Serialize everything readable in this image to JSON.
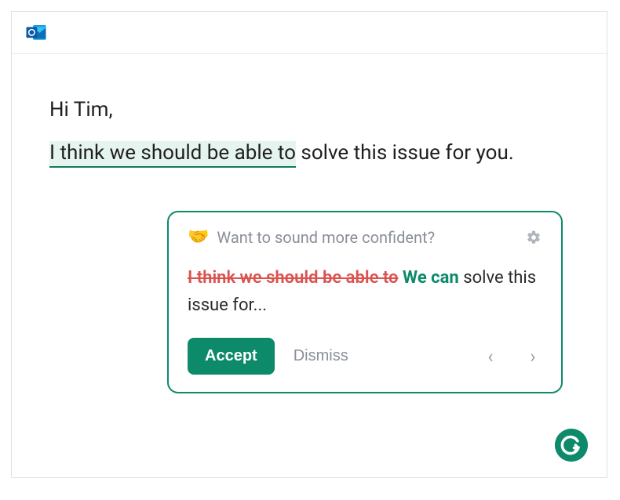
{
  "email": {
    "greeting": "Hi Tim,",
    "highlighted_phrase": "I think we should be able to",
    "rest_of_sentence": " solve this issue for you."
  },
  "suggestion": {
    "handshake_emoji": "🤝",
    "prompt": "Want to sound more confident?",
    "strike_text": "I think we should be able to",
    "replacement_text": " We can",
    "trailing_text": " solve this issue for...",
    "accept_label": "Accept",
    "dismiss_label": "Dismiss"
  },
  "icons": {
    "outlook": "outlook-icon",
    "gear": "gear-icon",
    "prev": "‹",
    "next": "›",
    "grammarly": "grammarly-icon"
  },
  "colors": {
    "accent_green": "#0d8a6a",
    "strike_red": "#d9534f",
    "muted_gray": "#8a8f99"
  }
}
